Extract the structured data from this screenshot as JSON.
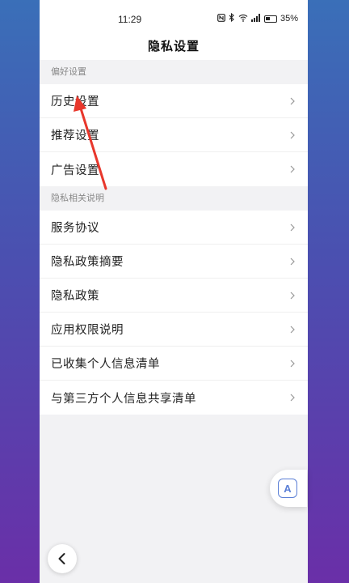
{
  "status_bar": {
    "time": "11:29",
    "battery": "35%",
    "icons": [
      "nfc-icon",
      "bluetooth-icon",
      "wifi-icon",
      "signal-icon",
      "battery-icon"
    ]
  },
  "header": {
    "title": "隐私设置"
  },
  "sections": [
    {
      "title": "偏好设置",
      "items": [
        {
          "label": "历史设置"
        },
        {
          "label": "推荐设置"
        },
        {
          "label": "广告设置"
        }
      ]
    },
    {
      "title": "隐私相关说明",
      "items": [
        {
          "label": "服务协议"
        },
        {
          "label": "隐私政策摘要"
        },
        {
          "label": "隐私政策"
        },
        {
          "label": "应用权限说明"
        },
        {
          "label": "已收集个人信息清单"
        },
        {
          "label": "与第三方个人信息共享清单"
        }
      ]
    }
  ],
  "floating_button": {
    "glyph": "A"
  },
  "colors": {
    "accent": "#5b7fd6",
    "annotation_arrow": "#e8372c",
    "list_background": "#ffffff",
    "page_background": "#f2f2f4"
  }
}
